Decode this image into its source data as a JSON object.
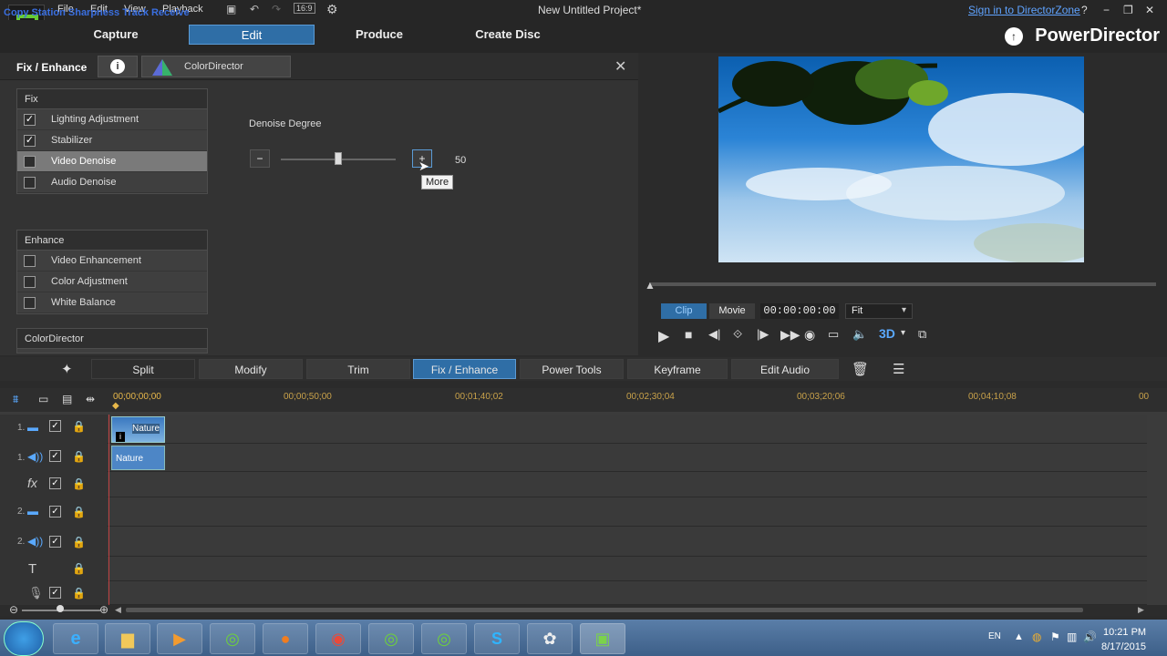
{
  "titlebar": {
    "menus": [
      "File",
      "Edit",
      "View",
      "Playback"
    ],
    "project_title": "New Untitled Project*",
    "sign_in": "Sign in to DirectorZone",
    "help": "?",
    "aspect_badge": "16:9",
    "overlay_text": "Copy Station Sharpness Track Receive"
  },
  "nav": {
    "capture": "Capture",
    "edit": "Edit",
    "produce": "Produce",
    "create_disc": "Create Disc",
    "brand": "PowerDirector"
  },
  "panel": {
    "title": "Fix / Enhance",
    "colordirector_tab": "ColorDirector",
    "fix_group": {
      "header": "Fix",
      "items": [
        {
          "label": "Lighting Adjustment",
          "checked": true,
          "selected": false
        },
        {
          "label": "Stabilizer",
          "checked": true,
          "selected": false
        },
        {
          "label": "Video Denoise",
          "checked": false,
          "selected": true
        },
        {
          "label": "Audio Denoise",
          "checked": false,
          "selected": false
        }
      ]
    },
    "enhance_group": {
      "header": "Enhance",
      "items": [
        {
          "label": "Video Enhancement",
          "checked": false
        },
        {
          "label": "Color Adjustment",
          "checked": false
        },
        {
          "label": "White Balance",
          "checked": false
        }
      ]
    },
    "colordirector_group": {
      "header": "ColorDirector"
    },
    "denoise": {
      "label": "Denoise Degree",
      "value": "50",
      "level": 0.5,
      "tooltip": "More"
    }
  },
  "player": {
    "clip_tab": "Clip",
    "movie_tab": "Movie",
    "timecode": "00:00:00:00",
    "fit": "Fit",
    "mode_3d": "3D"
  },
  "toolbar": {
    "split": "Split",
    "modify": "Modify",
    "trim": "Trim",
    "fix_enhance": "Fix / Enhance",
    "power_tools": "Power Tools",
    "keyframe": "Keyframe",
    "edit_audio": "Edit Audio"
  },
  "timeline": {
    "ruler": [
      "00;00;00;00",
      "00;00;50;00",
      "00;01;40;02",
      "00;02;30;04",
      "00;03;20;06",
      "00;04;10;08",
      "00"
    ],
    "tracks": [
      {
        "num": "1.",
        "type": "video"
      },
      {
        "num": "1.",
        "type": "audio"
      },
      {
        "num": "",
        "type": "fx"
      },
      {
        "num": "2.",
        "type": "video"
      },
      {
        "num": "2.",
        "type": "audio"
      },
      {
        "num": "",
        "type": "title"
      },
      {
        "num": "",
        "type": "voice"
      }
    ],
    "clip_video_label": "Nature",
    "clip_audio_label": "Nature"
  },
  "taskbar": {
    "lang": "EN",
    "time": "10:21 PM",
    "date": "8/17/2015"
  }
}
